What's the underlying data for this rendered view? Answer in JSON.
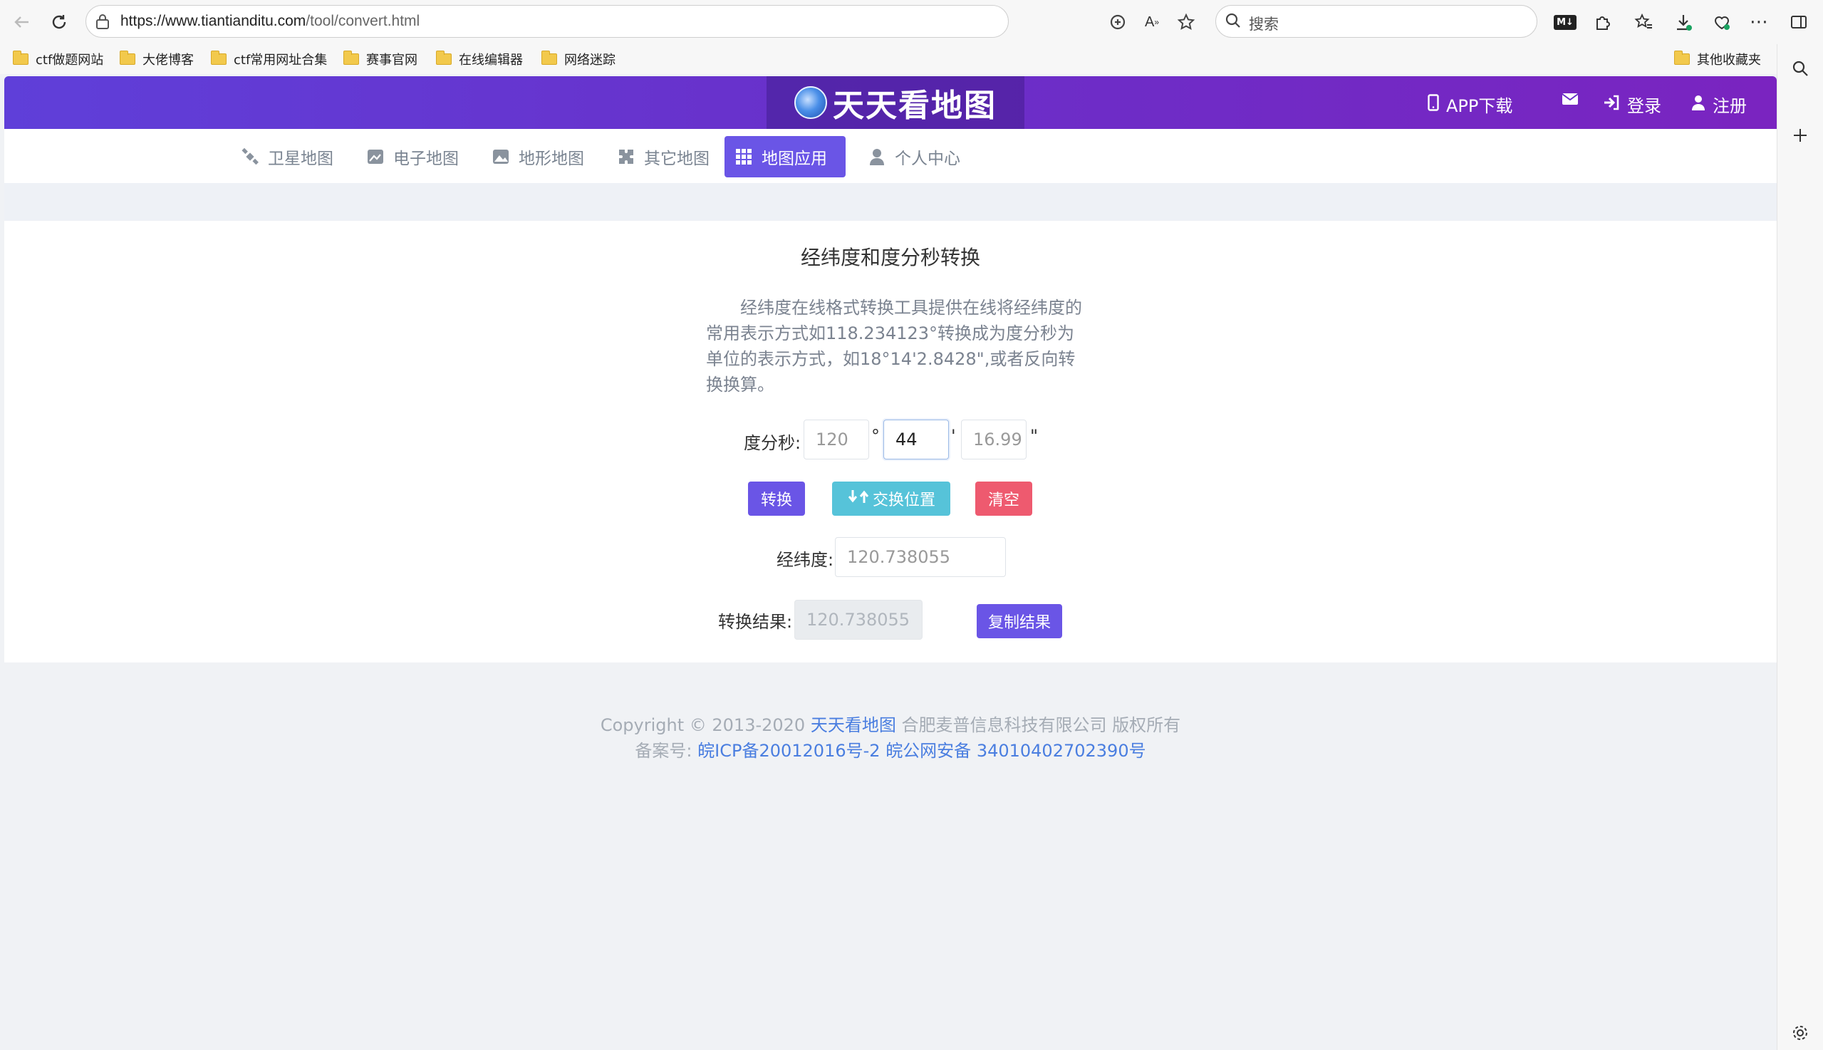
{
  "browser": {
    "url_host": "https://www.tiantianditu.com",
    "url_path": "/tool/convert.html",
    "search_placeholder": "搜索",
    "md_badge": "M↓"
  },
  "bookmarks": {
    "items": [
      "ctf做题网站",
      "大佬博客",
      "ctf常用网址合集",
      "赛事官网",
      "在线编辑器",
      "网络迷踪"
    ],
    "other": "其他收藏夹"
  },
  "header": {
    "logo_text": "天天看地图",
    "app_download": "APP下载",
    "login": "登录",
    "register": "注册"
  },
  "nav": {
    "items": [
      {
        "label": "卫星地图",
        "icon": "satellite-icon"
      },
      {
        "label": "电子地图",
        "icon": "map-icon"
      },
      {
        "label": "地形地图",
        "icon": "terrain-icon"
      },
      {
        "label": "其它地图",
        "icon": "puzzle-icon"
      },
      {
        "label": "地图应用",
        "icon": "grid-icon",
        "active": true
      },
      {
        "label": "个人中心",
        "icon": "user-icon"
      }
    ]
  },
  "tool": {
    "title": "经纬度和度分秒转换",
    "description": "经纬度在线格式转换工具提供在线将经纬度的常用表示方式如118.234123°转换成为度分秒为单位的表示方式，如18°14'2.8428\",或者反向转换换算。",
    "dms_label": "度分秒:",
    "degree_value": "120",
    "degree_symbol": "°",
    "minute_value": "44",
    "minute_symbol": "'",
    "second_value": "16.99",
    "second_symbol": "\"",
    "convert_button": "转换",
    "swap_button": "交换位置",
    "clear_button": "清空",
    "decimal_label": "经纬度:",
    "decimal_placeholder": "120.738055",
    "result_label": "转换结果:",
    "result_value": "120.738055",
    "copy_button": "复制结果"
  },
  "footer": {
    "copyright_prefix": "Copyright © 2013-2020",
    "site_name": "天天看地图",
    "copyright_suffix": "合肥麦普信息科技有限公司 版权所有",
    "icp_label": "备案号:",
    "icp_number": "皖ICP备20012016号-2",
    "police_number": "皖公网安备 34010402702390号"
  },
  "colors": {
    "accent": "#6a55e6",
    "header_start": "#5f3fd9",
    "header_end": "#7a24c0",
    "swap_button": "#56c3d9",
    "clear_button": "#ee5a6f",
    "link": "#4a7ee0"
  }
}
